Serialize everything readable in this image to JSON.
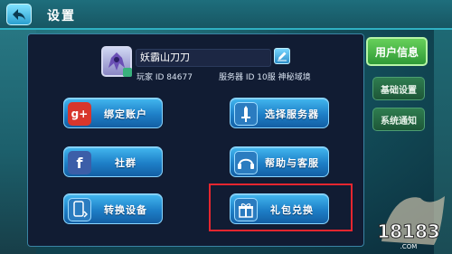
{
  "header": {
    "title": "设置",
    "back_icon": "back-arrow-icon"
  },
  "profile": {
    "name": "妖霸山刀刀",
    "player_id": "玩家 ID 84677",
    "server_info": "服务器 ID 10服 神秘域境",
    "edit_icon": "pencil-icon"
  },
  "buttons": {
    "bind_account": "绑定账户",
    "select_server": "选择服务器",
    "community": "社群",
    "help_service": "帮助与客服",
    "switch_device": "转换设备",
    "gift_redeem": "礼包兑换"
  },
  "tabs": {
    "user_info": "用户信息",
    "basic_settings": "基础设置",
    "system_notice": "系统通知"
  },
  "watermark": "18183",
  "colors": {
    "panel": "#111c33",
    "button": "#1e7fc7",
    "tab_active": "#2f9a37",
    "highlight": "#e5262f"
  }
}
